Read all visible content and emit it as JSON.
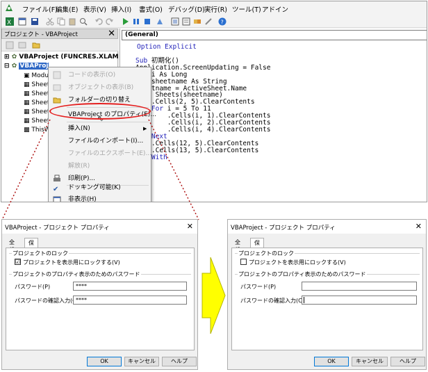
{
  "menubar": {
    "items": [
      "ファイル(F)",
      "編集(E)",
      "表示(V)",
      "挿入(I)",
      "書式(O)",
      "デバッグ(D)",
      "実行(R)",
      "ツール(T)",
      "アドイン"
    ]
  },
  "project_panel": {
    "title": "プロジェクト - VBAProject",
    "tree": [
      "VBAProject (FUNCRES.XLAM",
      "VBAProj",
      "Modul",
      "Sheet",
      "Sheet",
      "Sheet",
      "Sheet",
      "Sheet",
      "ThisW"
    ]
  },
  "code_pane": {
    "combo": "(General)",
    "lines": [
      {
        "kw": "Option Explicit",
        "rest": ""
      },
      {
        "kw": "",
        "rest": ""
      },
      {
        "kw": "Sub",
        "rest": " 初期化()"
      },
      {
        "kw": "",
        "rest": "Application.ScreenUpdating = False"
      },
      {
        "kw": "Dim",
        "rest": " i As Long"
      },
      {
        "kw": "Dim",
        "rest": " sheetname As String"
      },
      {
        "kw": "",
        "rest": "sheetname = ActiveSheet.Name"
      },
      {
        "kw": "With",
        "rest": " Sheets(sheetname)"
      },
      {
        "kw": "",
        "rest": "    .Cells(2, 5).ClearContents"
      },
      {
        "kw": "    For",
        "rest": " i = 5 To 11"
      },
      {
        "kw": "",
        "rest": "        .Cells(i, 1).ClearContents"
      },
      {
        "kw": "",
        "rest": "        .Cells(i, 2).ClearContents"
      },
      {
        "kw": "",
        "rest": "        .Cells(i, 4).ClearContents"
      },
      {
        "kw": "    Next",
        "rest": ""
      },
      {
        "kw": "",
        "rest": "    .Cells(12, 5).ClearContents"
      },
      {
        "kw": "",
        "rest": "    .Cells(13, 5).ClearContents"
      },
      {
        "kw": "End With",
        "rest": ""
      },
      {
        "kw": "",
        "rest": "Sub"
      }
    ]
  },
  "context_menu": {
    "items": [
      {
        "label": "コードの表示(O)",
        "disabled": true
      },
      {
        "label": "オブジェクトの表示(B)",
        "disabled": true
      },
      {
        "label": "フォルダーの切り替え",
        "disabled": false
      },
      {
        "label": "VBAProject のプロパティ(E)...",
        "disabled": false
      },
      {
        "label": "挿入(N)",
        "disabled": false
      },
      {
        "label": "ファイルのインポート(I)...",
        "disabled": false
      },
      {
        "label": "ファイルのエクスポート(E)...",
        "disabled": true
      },
      {
        "label": "解放(R)",
        "disabled": true
      },
      {
        "label": "印刷(P)...",
        "disabled": false
      },
      {
        "label": "ドッキング可能(K)",
        "disabled": false
      },
      {
        "label": "非表示(H)",
        "disabled": false
      }
    ]
  },
  "dialog_before": {
    "title": "VBAProject - プロジェクト プロパティ",
    "tab_general": "全般",
    "tab_protection": "保護",
    "lock_group": "プロジェクトのロック",
    "lock_checkbox": "プロジェクトを表示用にロックする(V)",
    "lock_checked": "☑",
    "password_group": "プロジェクトのプロパティ表示のためのパスワード",
    "password_label": "パスワード(P)",
    "password_value": "****",
    "confirm_label": "パスワードの確認入力(C)",
    "confirm_value": "****",
    "ok": "OK",
    "cancel": "キャンセル",
    "help": "ヘルプ"
  },
  "dialog_after": {
    "title": "VBAProject - プロジェクト プロパティ",
    "tab_general": "全般",
    "tab_protection": "保護",
    "lock_group": "プロジェクトのロック",
    "lock_checkbox": "プロジェクトを表示用にロックする(V)",
    "password_group": "プロジェクトのプロパティ表示のためのパスワード",
    "password_label": "パスワード(P)",
    "password_value": "",
    "confirm_label": "パスワードの確認入力(C)",
    "confirm_value": "",
    "ok": "OK",
    "cancel": "キャンセル",
    "help": "ヘルプ"
  },
  "colors": {
    "highlight_ellipse": "#e41f1f",
    "dotted_connector": "#b01818",
    "arrow_fill": "#ffff00",
    "keyword": "#1f1fb8"
  }
}
